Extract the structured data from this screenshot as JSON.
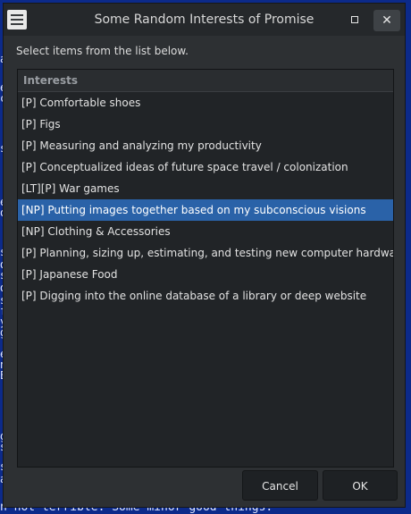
{
  "background": {
    "bottom_text": "n not terrible. Some minor good things.",
    "left_fragments": [
      "a",
      "e",
      "c",
      "s",
      "e",
      "o",
      "s",
      "d",
      "s",
      "d",
      "s",
      "f",
      "y",
      "g",
      "e",
      "n",
      "E",
      "g",
      "s",
      "s",
      "a"
    ]
  },
  "window": {
    "title": "Some Random Interests of Promise",
    "instructions": "Select items from the list below.",
    "list": {
      "header": "Interests",
      "items": [
        "[P] Comfortable shoes",
        "[P] Figs",
        "[P] Measuring and analyzing my productivity",
        "[P] Conceptualized ideas of future space travel / colonization",
        "[LT][P] War games",
        "[NP] Putting images together based on my subconscious visions",
        "[NP] Clothing & Accessories",
        "[P] Planning, sizing up, estimating, and testing new computer hardware",
        "[P] Japanese Food",
        "[P] Digging into the online database of a library or deep website"
      ],
      "selected_index": 5
    },
    "buttons": {
      "cancel": "Cancel",
      "ok": "OK"
    }
  },
  "colors": {
    "selection": "#2a62a8",
    "desktop": "#0c2a8a"
  }
}
